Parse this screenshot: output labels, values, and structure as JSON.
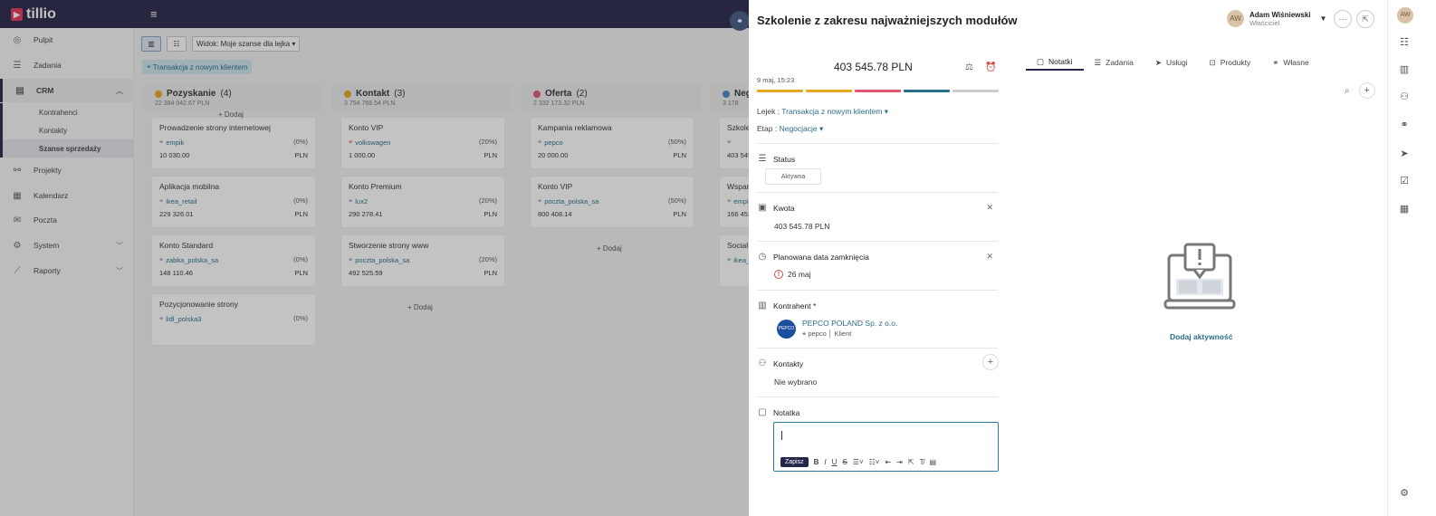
{
  "app": {
    "logo": "tillio",
    "hamburger": "≡"
  },
  "sidebar": {
    "items": [
      {
        "label": "Pulpit",
        "icon": "◎"
      },
      {
        "label": "Zadania",
        "icon": "☰"
      },
      {
        "label": "CRM",
        "icon": "▤"
      },
      {
        "label": "Projekty",
        "icon": "⚯"
      },
      {
        "label": "Kalendarz",
        "icon": "▦"
      },
      {
        "label": "Poczta",
        "icon": "✉"
      },
      {
        "label": "System",
        "icon": "⚙"
      },
      {
        "label": "Raporty",
        "icon": "⟋"
      }
    ],
    "crm_sub": [
      "Kontrahenci",
      "Kontakty",
      "Szanse sprzedaży"
    ]
  },
  "toolbar": {
    "view_label": "Widok: Moje szanse dla lejka ▾",
    "funnel_label": "Transakcja z nowym klientem"
  },
  "columns": [
    {
      "title": "Pozyskanie",
      "count": "(4)",
      "sum": "22 384 042.67 PLN",
      "color": "#e8a623",
      "cards": [
        {
          "title": "Prowadzenie strony internetowej",
          "tag": "empik",
          "pct": "(0%)",
          "amount": "10 030.00",
          "cur": "PLN"
        },
        {
          "title": "Aplikacja mobilna",
          "tag": "ikea_retail",
          "pct": "(0%)",
          "amount": "229 326.01",
          "cur": "PLN"
        },
        {
          "title": "Konto Standard",
          "tag": "zabka_polska_sa",
          "pct": "(0%)",
          "amount": "148 110.46",
          "cur": "PLN"
        },
        {
          "title": "Pozycjonowanie strony",
          "tag": "lidl_polska3",
          "pct": "(0%)",
          "amount": "",
          "cur": ""
        }
      ],
      "add": "+ Dodaj"
    },
    {
      "title": "Kontakt",
      "count": "(3)",
      "sum": "3 754 766.54 PLN",
      "color": "#e8a623",
      "cards": [
        {
          "title": "Konto VIP",
          "tag": "volkswagen",
          "pct": "(20%)",
          "amount": "1 000.00",
          "cur": "PLN"
        },
        {
          "title": "Konto Premium",
          "tag": "lux2",
          "pct": "(20%)",
          "amount": "290 278.41",
          "cur": "PLN"
        },
        {
          "title": "Stworzenie strony www",
          "tag": "poczta_polska_sa",
          "pct": "(20%)",
          "amount": "492 525.59",
          "cur": "PLN"
        }
      ],
      "add": "+ Dodaj"
    },
    {
      "title": "Oferta",
      "count": "(2)",
      "sum": "2 332 173.32 PLN",
      "color": "#e0556f",
      "cards": [
        {
          "title": "Kampania reklamowa",
          "tag": "pepco",
          "pct": "(50%)",
          "amount": "20 000.00",
          "cur": "PLN"
        },
        {
          "title": "Konto VIP",
          "tag": "poczta_polska_sa",
          "pct": "(50%)",
          "amount": "800 408.14",
          "cur": "PLN"
        }
      ],
      "add": "+ Dodaj"
    },
    {
      "title": "Neg",
      "count": "",
      "sum": "3 178",
      "color": "#4a84c0",
      "cards": [
        {
          "title": "Szkolen",
          "tag": "",
          "pct": "",
          "amount": "403 545.",
          "cur": ""
        },
        {
          "title": "Wsparci",
          "tag": "empik",
          "pct": "",
          "amount": "166 453.",
          "cur": ""
        },
        {
          "title": "Social m",
          "tag": "ikea_",
          "pct": "",
          "amount": "",
          "cur": ""
        }
      ],
      "add": ""
    }
  ],
  "panel": {
    "title": "Szkolenie z zakresu najważniejszych modułów",
    "owner_name": "Adam Wiśniewski",
    "owner_role": "Właściciel",
    "amount": "403 545.78 PLN",
    "date": "9 maj, 15:23",
    "stage_colors": [
      "#e8a623",
      "#e8a623",
      "#e0556f",
      "#2a6d8a",
      "#cccccc"
    ],
    "lejek_label": "Lejek :",
    "lejek_value": "Transakcja z nowym klientem ▾",
    "etap_label": "Etap :",
    "etap_value": "Negocjacje ▾",
    "status_label": "Status",
    "status_value": "Aktywna",
    "kwota_label": "Kwota",
    "kwota_value": "403 545.78 PLN",
    "close_date_label": "Planowana data zamknięcia",
    "close_date_value": "26 maj",
    "kontrahent_label": "Kontrahent *",
    "firm_name": "PEPCO POLAND Sp. z o.o.",
    "firm_tags": "pepco │ Klient",
    "kontakty_label": "Kontakty",
    "kontakty_value": "Nie wybrano",
    "notatka_label": "Notatka",
    "save_label": "Zapisz",
    "tabs": [
      "Notatki",
      "Zadania",
      "Usługi",
      "Produkty",
      "Własne"
    ],
    "add_activity": "Dodaj aktywność"
  }
}
